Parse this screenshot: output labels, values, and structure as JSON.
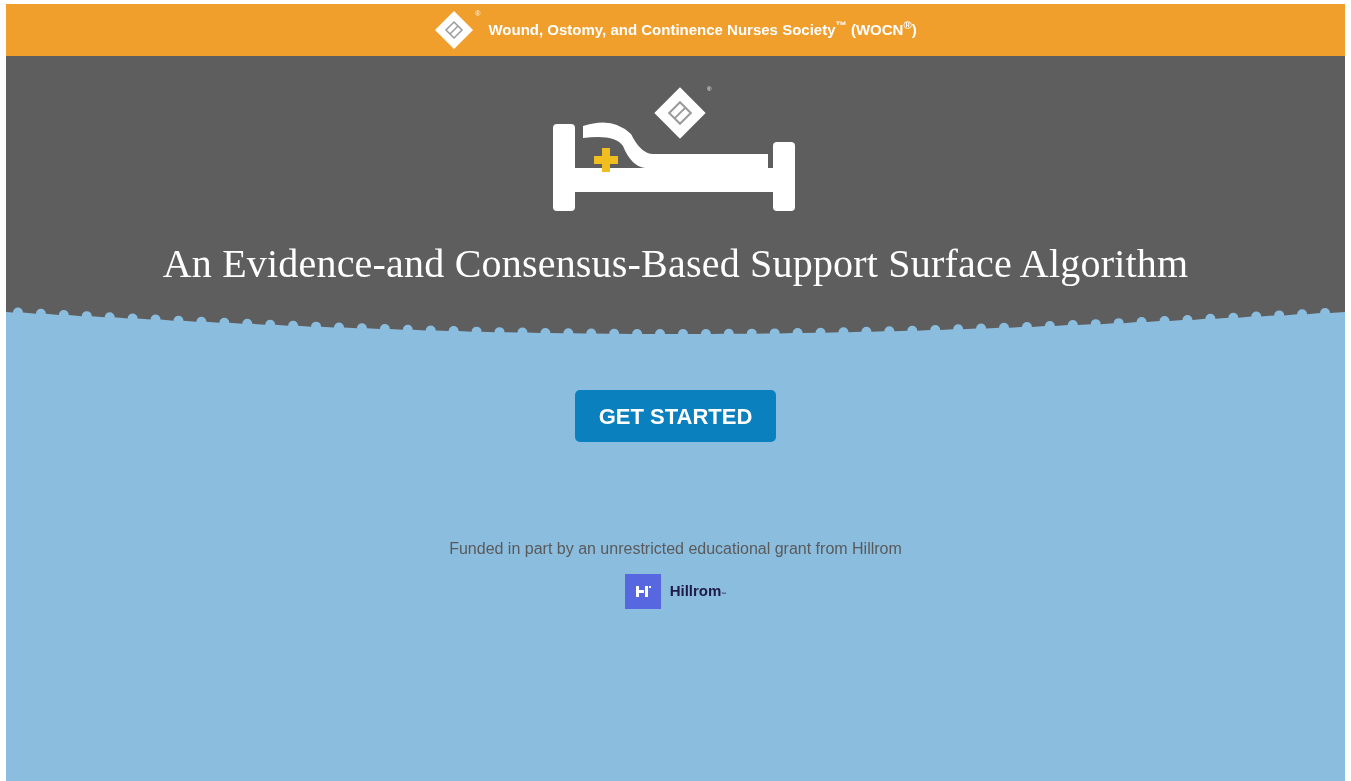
{
  "header": {
    "logo_mark": "®",
    "title": "Wound, Ostomy, and Continence Nurses Society$^{™}$ (WOCN$^{®}$)"
  },
  "hero": {
    "logo_mark": "®",
    "title": "An Evidence-and Consensus-Based Support Surface Algorithm"
  },
  "cta": {
    "label": "GET STARTED"
  },
  "funding": {
    "text": "Funded in part by an unrestricted educational grant from Hillrom",
    "sponsor": {
      "name": "Hillrom",
      "mark": "™"
    }
  }
}
